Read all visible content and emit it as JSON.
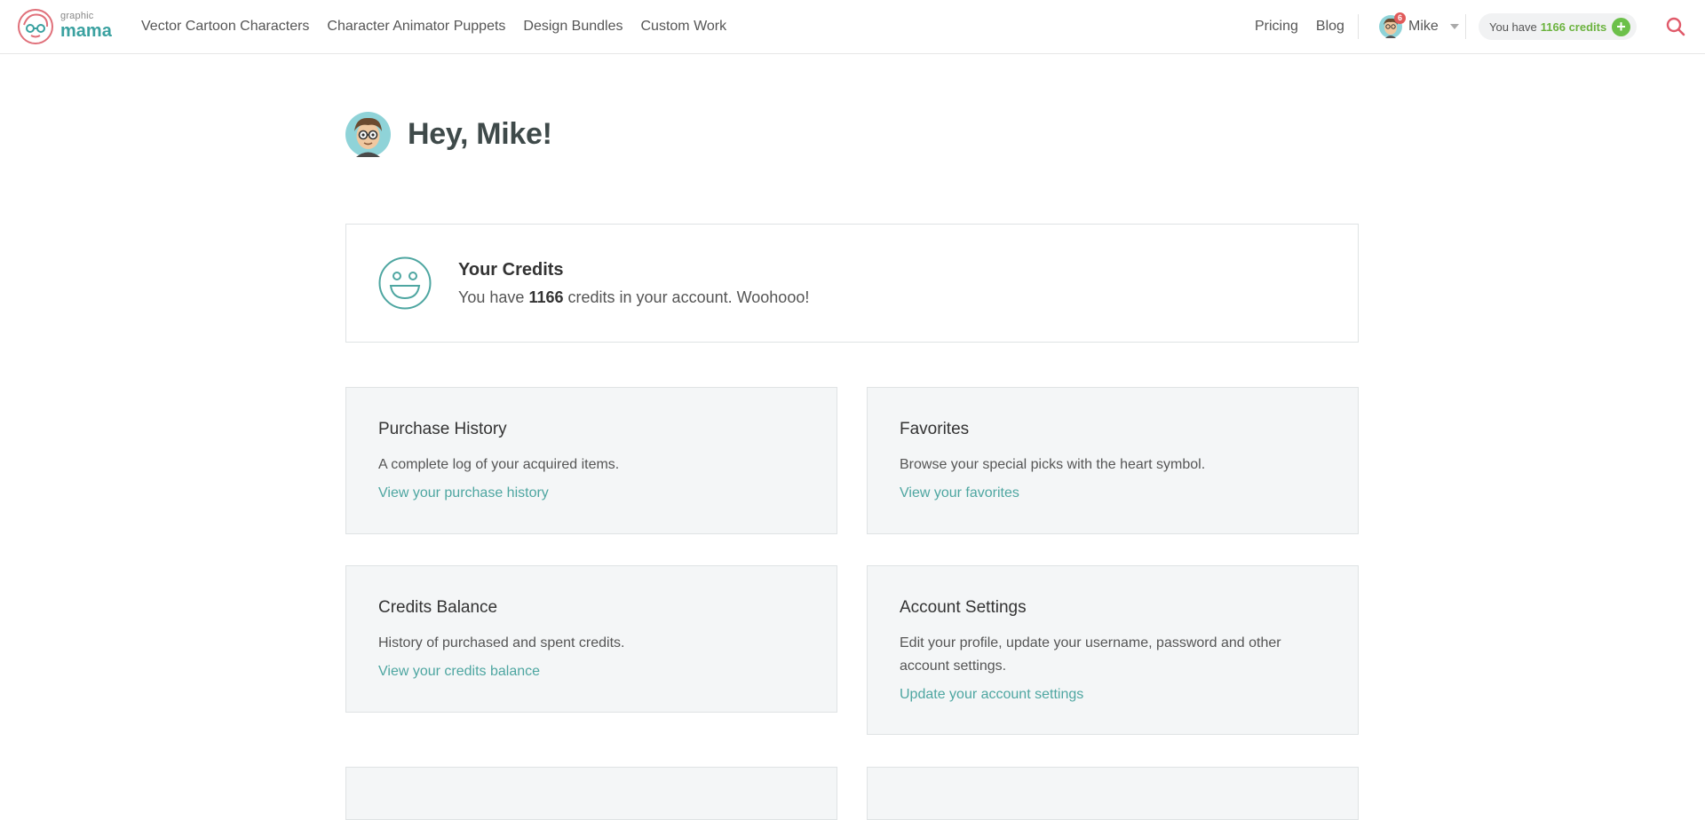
{
  "brand": {
    "small": "graphic",
    "big": "mama"
  },
  "nav": {
    "main": [
      "Vector Cartoon Characters",
      "Character Animator Puppets",
      "Design Bundles",
      "Custom Work"
    ],
    "right": [
      "Pricing",
      "Blog"
    ]
  },
  "user": {
    "name": "Mike",
    "notifications": "6"
  },
  "credits_pill": {
    "prefix": "You have",
    "amount": "1166 credits",
    "add": "+"
  },
  "greeting": "Hey, Mike!",
  "credits_box": {
    "title": "Your Credits",
    "text_before": "You have",
    "amount": "1166",
    "text_after": "credits in your account. Woohooo!"
  },
  "cards": [
    {
      "title": "Purchase History",
      "desc": "A complete log of your acquired items.",
      "link": "View your purchase history"
    },
    {
      "title": "Favorites",
      "desc": "Browse your special picks with the heart symbol.",
      "link": "View your favorites"
    },
    {
      "title": "Credits Balance",
      "desc": "History of purchased and spent credits.",
      "link": "View your credits balance"
    },
    {
      "title": "Account Settings",
      "desc": "Edit your profile, update your username, password and other account settings.",
      "link": "Update your account settings"
    }
  ],
  "colors": {
    "accent": "#4ea6a1",
    "credits_green": "#6cb33f",
    "search": "#e05a6a",
    "card_bg": "#f4f6f7"
  },
  "icons": [
    "graphic-mama-logo",
    "avatar",
    "caret-down-icon",
    "plus-icon",
    "search-icon",
    "smiley-icon"
  ]
}
